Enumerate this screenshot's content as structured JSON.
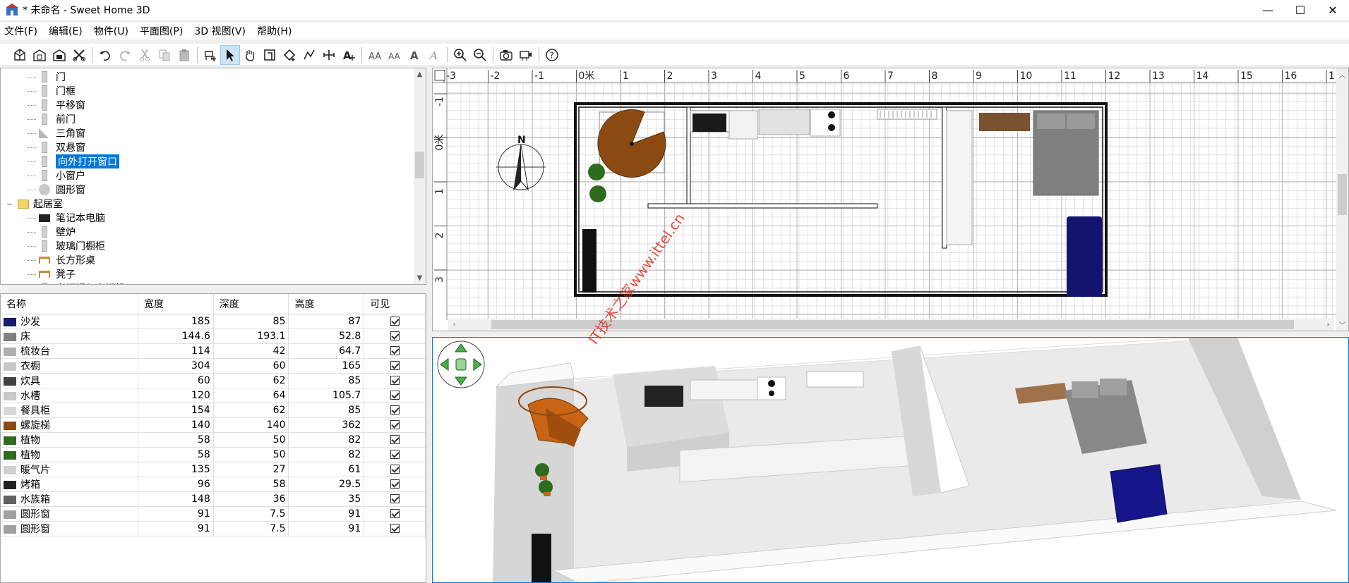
{
  "window": {
    "title": "* 未命名 - Sweet Home 3D",
    "minimize": "—",
    "maximize": "☐",
    "close": "✕"
  },
  "menu": [
    "文件(F)",
    "编辑(E)",
    "物件(U)",
    "平面图(P)",
    "3D 视图(V)",
    "帮助(H)"
  ],
  "toolbar": [
    "new-home-icon",
    "open-icon",
    "save-icon",
    "cut-tool-icon",
    "undo-icon",
    "redo-icon",
    "cut-icon",
    "copy-icon",
    "paste-icon",
    "add-furniture-icon",
    "select-mode-icon",
    "pan-mode-icon",
    "create-walls-icon",
    "create-rooms-icon",
    "create-polylines-icon",
    "create-dimensions-icon",
    "add-text-icon",
    "increase-text-icon",
    "decrease-text-icon",
    "bold-text-icon",
    "italic-text-icon",
    "zoom-in-icon",
    "zoom-out-icon",
    "create-photo-icon",
    "create-video-icon",
    "help-icon"
  ],
  "catalog": {
    "items": [
      {
        "label": "门",
        "level": 2,
        "icon": "door-icon"
      },
      {
        "label": "门框",
        "level": 2,
        "icon": "door-frame-icon"
      },
      {
        "label": "平移窗",
        "level": 2,
        "icon": "sliding-window-icon"
      },
      {
        "label": "前门",
        "level": 2,
        "icon": "front-door-icon"
      },
      {
        "label": "三角窗",
        "level": 2,
        "icon": "triangle-window-icon"
      },
      {
        "label": "双悬窗",
        "level": 2,
        "icon": "double-hung-window-icon"
      },
      {
        "label": "向外打开窗口",
        "level": 2,
        "icon": "outward-window-icon",
        "selected": true
      },
      {
        "label": "小窗户",
        "level": 2,
        "icon": "small-window-icon"
      },
      {
        "label": "圆形窗",
        "level": 2,
        "icon": "round-window-icon"
      },
      {
        "label": "起居室",
        "level": 1,
        "icon": "folder-icon",
        "expand": "−"
      },
      {
        "label": "笔记本电脑",
        "level": 2,
        "icon": "laptop-icon"
      },
      {
        "label": "壁炉",
        "level": 2,
        "icon": "fireplace-icon"
      },
      {
        "label": "玻璃门橱柜",
        "level": 2,
        "icon": "glass-cabinet-icon"
      },
      {
        "label": "长方形桌",
        "level": 2,
        "icon": "rect-table-icon"
      },
      {
        "label": "凳子",
        "level": 2,
        "icon": "stool-icon"
      },
      {
        "label": "电视柜与电视机",
        "level": 2,
        "icon": "tv-unit-icon"
      }
    ]
  },
  "furniture": {
    "columns": [
      "名称",
      "宽度",
      "深度",
      "高度",
      "可见"
    ],
    "rows": [
      {
        "name": "沙发",
        "w": "185",
        "d": "85",
        "h": "87",
        "visible": true,
        "color": "#1a1a6e"
      },
      {
        "name": "床",
        "w": "144.6",
        "d": "193.1",
        "h": "52.8",
        "visible": true,
        "color": "#808080"
      },
      {
        "name": "梳妆台",
        "w": "114",
        "d": "42",
        "h": "64.7",
        "visible": true,
        "color": "#b0b0b0"
      },
      {
        "name": "衣橱",
        "w": "304",
        "d": "60",
        "h": "165",
        "visible": true,
        "color": "#c8c8c8"
      },
      {
        "name": "炊具",
        "w": "60",
        "d": "62",
        "h": "85",
        "visible": true,
        "color": "#404040"
      },
      {
        "name": "水槽",
        "w": "120",
        "d": "64",
        "h": "105.7",
        "visible": true,
        "color": "#c8c8c8"
      },
      {
        "name": "餐具柜",
        "w": "154",
        "d": "62",
        "h": "85",
        "visible": true,
        "color": "#d8d8d8"
      },
      {
        "name": "螺旋梯",
        "w": "140",
        "d": "140",
        "h": "362",
        "visible": true,
        "color": "#8b4a12"
      },
      {
        "name": "植物",
        "w": "58",
        "d": "50",
        "h": "82",
        "visible": true,
        "color": "#2e6b1e"
      },
      {
        "name": "植物",
        "w": "58",
        "d": "50",
        "h": "82",
        "visible": true,
        "color": "#2e6b1e"
      },
      {
        "name": "暖气片",
        "w": "135",
        "d": "27",
        "h": "61",
        "visible": true,
        "color": "#d0d0d0"
      },
      {
        "name": "烤箱",
        "w": "96",
        "d": "58",
        "h": "29.5",
        "visible": true,
        "color": "#202020"
      },
      {
        "name": "水族箱",
        "w": "148",
        "d": "36",
        "h": "35",
        "visible": true,
        "color": "#606060"
      },
      {
        "name": "圆形窗",
        "w": "91",
        "d": "7.5",
        "h": "91",
        "visible": true,
        "color": "#a0a0a0"
      },
      {
        "name": "圆形窗",
        "w": "91",
        "d": "7.5",
        "h": "91",
        "visible": true,
        "color": "#a0a0a0"
      }
    ]
  },
  "plan": {
    "ruler_x": [
      "-3",
      "-2",
      "-1",
      "0米",
      "1",
      "2",
      "3",
      "4",
      "5",
      "6",
      "7",
      "8",
      "9",
      "10",
      "11",
      "12",
      "13",
      "14",
      "15",
      "16",
      "1"
    ],
    "ruler_y": [
      "-1",
      "0米",
      "1",
      "2",
      "3"
    ],
    "compass_label": "N"
  },
  "watermark": "IT技术之家www.ittel.cn",
  "colors": {
    "selection": "#0078d7",
    "stairs": "#8b4a12",
    "sofa": "#14146e",
    "bed": "#7f7f7f",
    "desk": "#7a5230"
  }
}
